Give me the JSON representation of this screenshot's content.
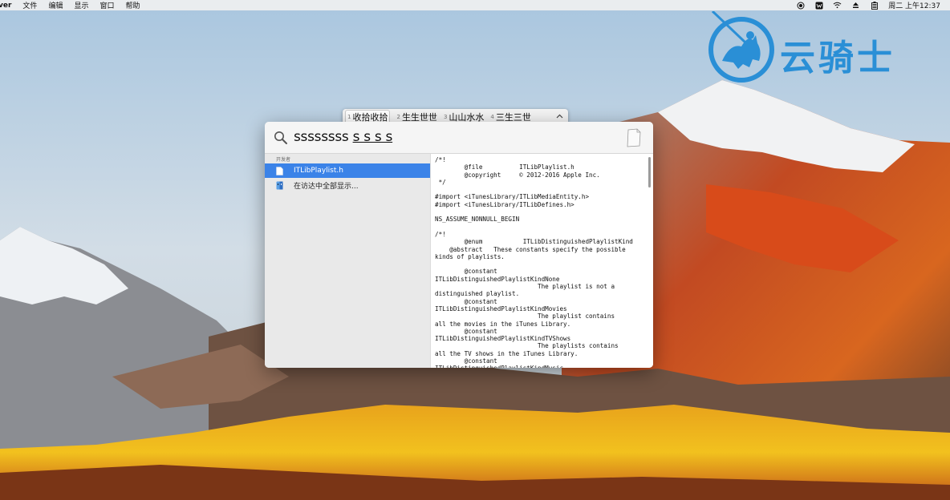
{
  "menubar": {
    "app_name": "ver",
    "items": [
      "文件",
      "编辑",
      "显示",
      "窗口",
      "帮助"
    ],
    "status_icons": [
      "record-icon",
      "wechat-icon",
      "wifi-icon",
      "eject-icon",
      "battery-icon"
    ],
    "clock": "周二 上午12:37"
  },
  "watermark": {
    "text": "云骑士",
    "color": "#2a8fd6"
  },
  "ime": {
    "candidates": [
      {
        "num": "1",
        "text": "收拾收拾"
      },
      {
        "num": "2",
        "text": "生生世世"
      },
      {
        "num": "3",
        "text": "山山水水"
      },
      {
        "num": "4",
        "text": "三生三世"
      }
    ],
    "expand_icon": "chevron-up-icon"
  },
  "spotlight": {
    "query_committed": "ssssssss",
    "query_marked": "s s s s",
    "section_label": "开发者",
    "results": [
      {
        "label": "ITLibPlaylist.h",
        "icon": "header-file-icon",
        "selected": true
      },
      {
        "label": "在访达中全部显示...",
        "icon": "finder-icon",
        "selected": false
      }
    ],
    "accent_color": "#3b83e8",
    "preview_text": "/*!\n        @file          ITLibPlaylist.h\n        @copyright     © 2012-2016 Apple Inc.\n */\n\n#import <iTunesLibrary/ITLibMediaEntity.h>\n#import <iTunesLibrary/ITLibDefines.h>\n\nNS_ASSUME_NONNULL_BEGIN\n\n/*!\n        @enum           ITLibDistinguishedPlaylistKind\n    @abstract   These constants specify the possible\nkinds of playlists.\n\n        @constant\nITLibDistinguishedPlaylistKindNone\n                            The playlist is not a\ndistinguished playlist.\n        @constant\nITLibDistinguishedPlaylistKindMovies\n                            The playlist contains\nall the movies in the iTunes Library.\n        @constant\nITLibDistinguishedPlaylistKindTVShows\n                            The playlists contains\nall the TV shows in the iTunes Library.\n        @constant\nITLibDistinguishedPlaylistKindMusic"
  }
}
